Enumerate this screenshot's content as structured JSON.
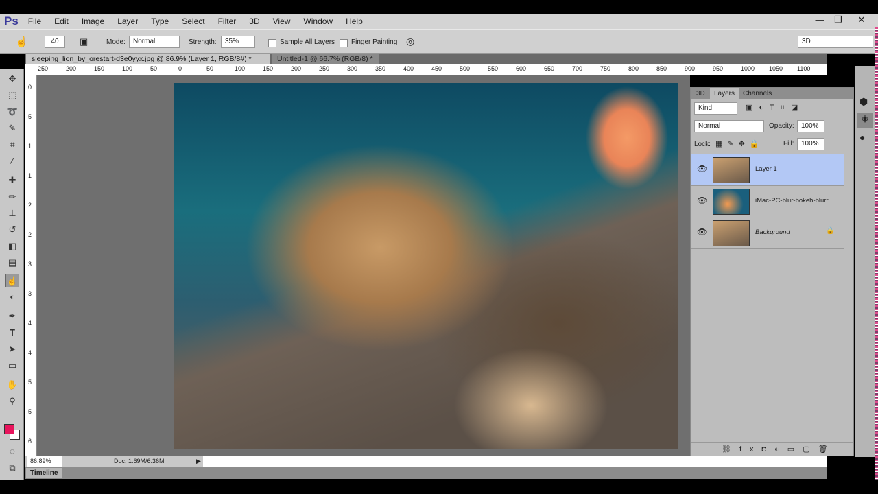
{
  "app": {
    "logo": "Ps",
    "menus": [
      "File",
      "Edit",
      "Image",
      "Layer",
      "Type",
      "Select",
      "Filter",
      "3D",
      "View",
      "Window",
      "Help"
    ],
    "window_controls": [
      "—",
      "❐",
      "✕"
    ]
  },
  "options": {
    "brush_size": "40",
    "mode_label": "Mode:",
    "mode_value": "Normal",
    "strength_label": "Strength:",
    "strength_value": "35%",
    "sample_all_layers": "Sample All Layers",
    "finger_painting": "Finger Painting",
    "workspace": "3D"
  },
  "tabs": [
    {
      "label": "sleeping_lion_by_orestart-d3e0yyx.jpg @ 86.9% (Layer 1, RGB/8#) *",
      "active": true
    },
    {
      "label": "Untitled-1 @ 66.7% (RGB/8) *",
      "active": false
    }
  ],
  "ruler": {
    "h_labels": [
      "250",
      "200",
      "150",
      "100",
      "50",
      "0",
      "50",
      "100",
      "150",
      "200",
      "250",
      "300",
      "350",
      "400",
      "450",
      "500",
      "550",
      "600",
      "650",
      "700",
      "750",
      "800",
      "850",
      "900",
      "950",
      "1000",
      "1050",
      "1100"
    ],
    "v_labels": [
      "0",
      "5",
      "1",
      "1",
      "2",
      "2",
      "3",
      "3",
      "4",
      "4",
      "5",
      "5",
      "6"
    ]
  },
  "status": {
    "zoom": "86.89%",
    "doc": "Doc: 1.69M/6.36M"
  },
  "timeline": {
    "label": "Timeline"
  },
  "layers_panel": {
    "tabs": [
      "3D",
      "Layers",
      "Channels"
    ],
    "filter": "Kind",
    "blend_mode": "Normal",
    "opacity_label": "Opacity:",
    "opacity": "100%",
    "lock_label": "Lock:",
    "fill_label": "Fill:",
    "fill": "100%",
    "layers": [
      {
        "name": "Layer 1",
        "selected": true,
        "visible": true
      },
      {
        "name": "iMac-PC-blur-bokeh-blurr...",
        "selected": false,
        "visible": true
      },
      {
        "name": "Background",
        "selected": false,
        "visible": true,
        "locked": true
      }
    ]
  },
  "colors": {
    "foreground": "#e8145c",
    "background": "#ffffff",
    "selection": "#b3c8f5"
  }
}
